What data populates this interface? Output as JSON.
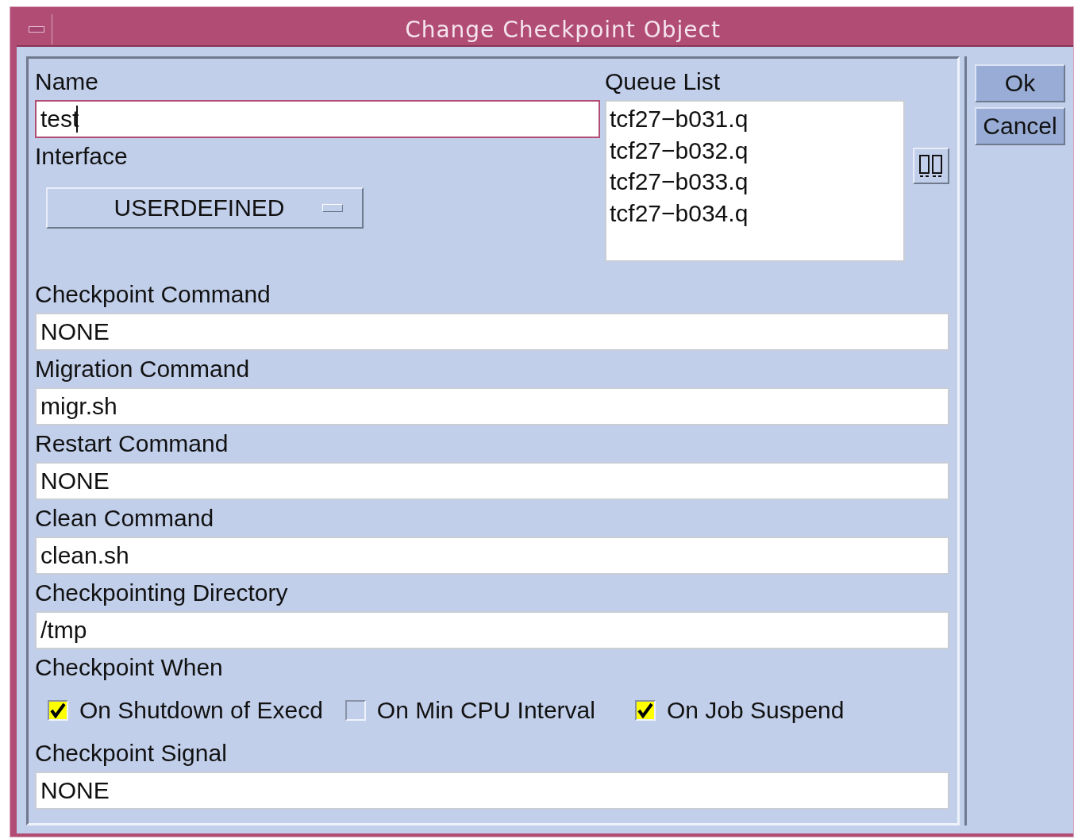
{
  "window": {
    "title": "Change Checkpoint Object"
  },
  "name": {
    "label": "Name",
    "value": "test",
    "focused": true
  },
  "interface": {
    "label": "Interface",
    "value": "USERDEFINED"
  },
  "queue_list": {
    "label": "Queue List",
    "items": [
      "tcf27−b031.q",
      "tcf27−b032.q",
      "tcf27−b033.q",
      "tcf27−b034.q"
    ]
  },
  "fields": [
    {
      "label": "Checkpoint Command",
      "value": "NONE"
    },
    {
      "label": "Migration Command",
      "value": "migr.sh"
    },
    {
      "label": "Restart Command",
      "value": "NONE"
    },
    {
      "label": "Clean Command",
      "value": "clean.sh"
    },
    {
      "label": "Checkpointing Directory",
      "value": "/tmp"
    }
  ],
  "checkpoint_when": {
    "label": "Checkpoint When",
    "options": [
      {
        "label": "On Shutdown of Execd",
        "checked": true
      },
      {
        "label": "On Min CPU Interval",
        "checked": false
      },
      {
        "label": "On Job Suspend",
        "checked": true
      }
    ]
  },
  "checkpoint_signal": {
    "label": "Checkpoint Signal",
    "value": "NONE"
  },
  "buttons": [
    "Ok",
    "Cancel"
  ]
}
